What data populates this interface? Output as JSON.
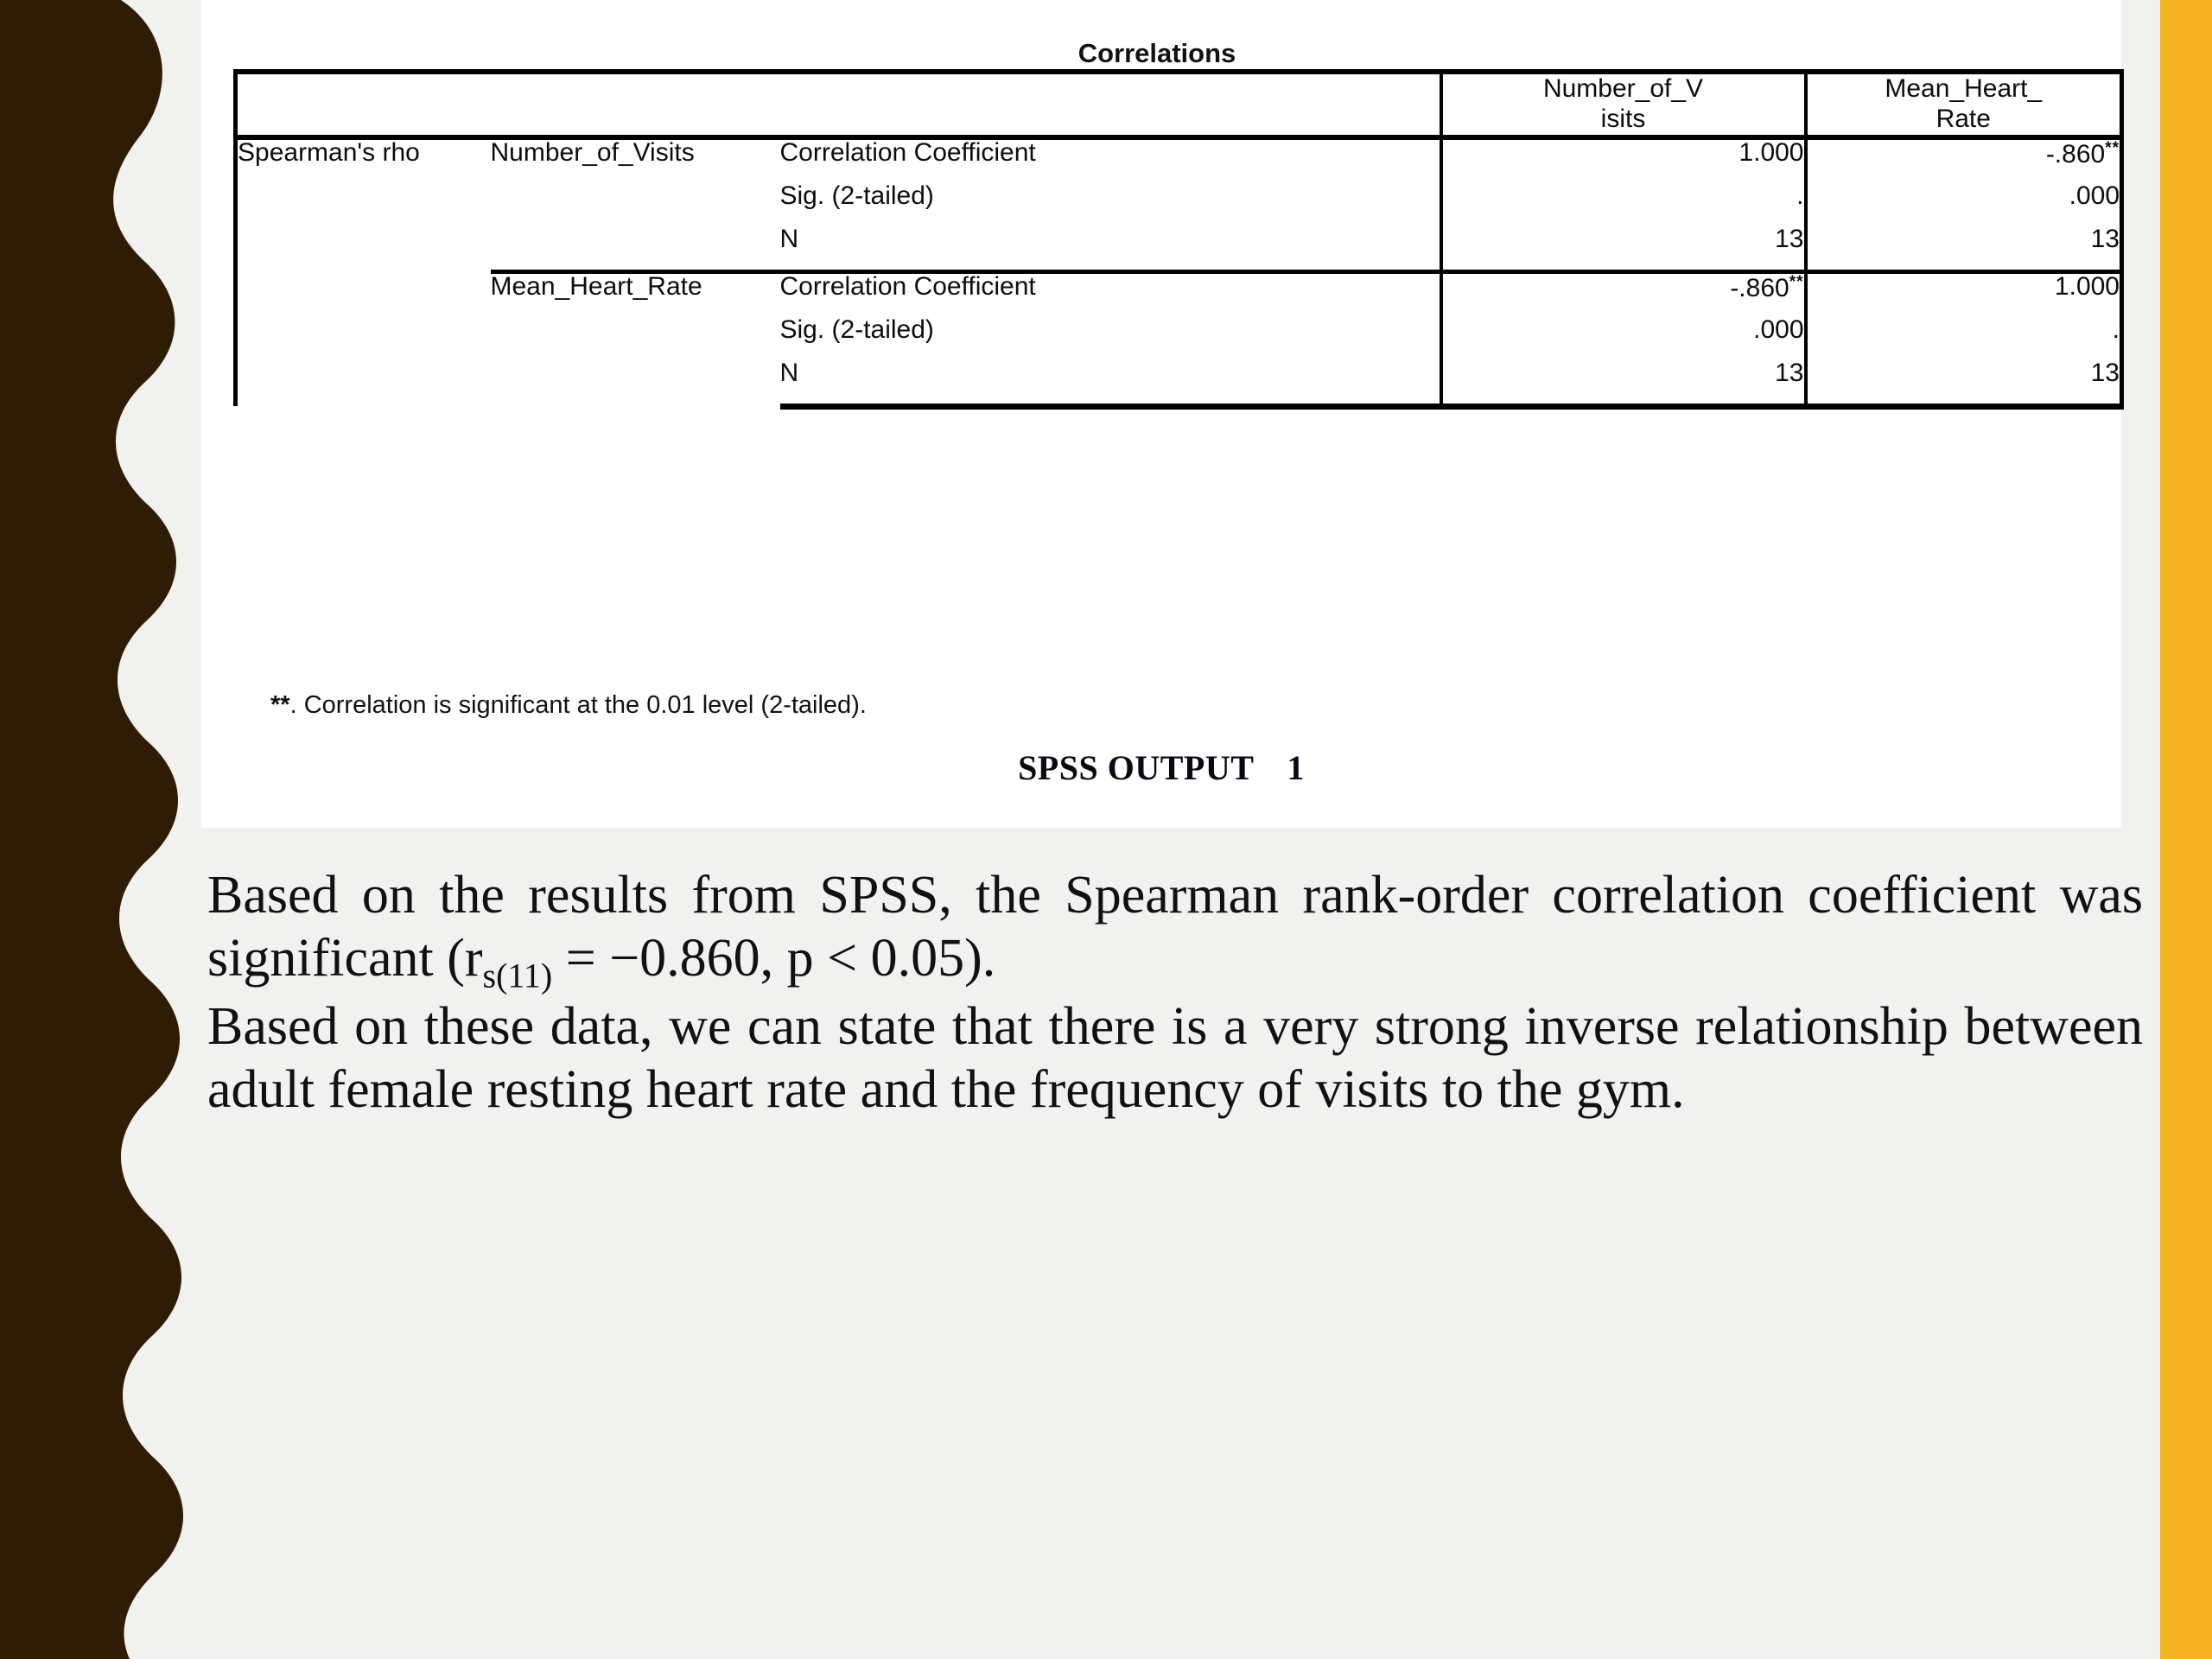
{
  "slide": {
    "background_color": "#f1f1ef",
    "accent_bar_color": "#F5B324",
    "wave_color": "#2E1C05"
  },
  "spss_output": {
    "title": "Correlations",
    "caption_label": "SPSS OUTPUT",
    "caption_number": "1",
    "footnote_stars": "**",
    "footnote_text": ". Correlation is significant at the 0.01 level (2-tailed).",
    "column_headers": [
      "",
      "Number_of_V isits",
      "Mean_Heart_ Rate"
    ],
    "column_header_lines": {
      "col1_line1": "Number_of_V",
      "col1_line2": "isits",
      "col2_line1": "Mean_Heart_",
      "col2_line2": "Rate"
    },
    "method_label": "Spearman's rho",
    "stat_labels": {
      "correlation_coefficient": "Correlation Coefficient",
      "sig_2_tailed": "Sig. (2-tailed)",
      "n": "N"
    },
    "rows": [
      {
        "variable": "Number_of_Visits",
        "correlation_coefficient": {
          "col1": "1.000",
          "col1_sup": "",
          "col2": "-.860",
          "col2_sup": "**"
        },
        "sig": {
          "col1": ".",
          "col2": ".000"
        },
        "n": {
          "col1": "13",
          "col2": "13"
        }
      },
      {
        "variable": "Mean_Heart_Rate",
        "correlation_coefficient": {
          "col1": "-.860",
          "col1_sup": "**",
          "col2": "1.000",
          "col2_sup": ""
        },
        "sig": {
          "col1": ".000",
          "col2": "."
        },
        "n": {
          "col1": "13",
          "col2": "13"
        }
      }
    ]
  },
  "chart_data": {
    "type": "table",
    "title": "Correlations",
    "subtitle": "Spearman's rho correlation matrix",
    "categories": [
      "Number_of_Visits",
      "Mean_Heart_Rate"
    ],
    "columns": [
      "Number_of_Visits",
      "Mean_Heart_Rate"
    ],
    "statistics": [
      "Correlation Coefficient",
      "Sig. (2-tailed)",
      "N"
    ],
    "matrix": {
      "correlation_coefficient": [
        [
          1.0,
          -0.86
        ],
        [
          -0.86,
          1.0
        ]
      ],
      "sig_2_tailed": [
        [
          null,
          0.0
        ],
        [
          0.0,
          null
        ]
      ],
      "n": [
        [
          13,
          13
        ],
        [
          13,
          13
        ]
      ]
    },
    "significance_note": "** Correlation is significant at the 0.01 level (2-tailed).",
    "annotations": [
      "SPSS OUTPUT 1"
    ]
  },
  "body": {
    "paragraph1_part1": "Based on the results from SPSS, the Spearman rank-order correlation coefficient was significant (r",
    "paragraph1_subscript": "s(11)",
    "paragraph1_part2": " = −0.860, p < 0.05).",
    "paragraph2": "Based on these data, we can state that there is a very strong inverse relationship between adult female resting heart rate and the frequency of visits to the gym."
  }
}
